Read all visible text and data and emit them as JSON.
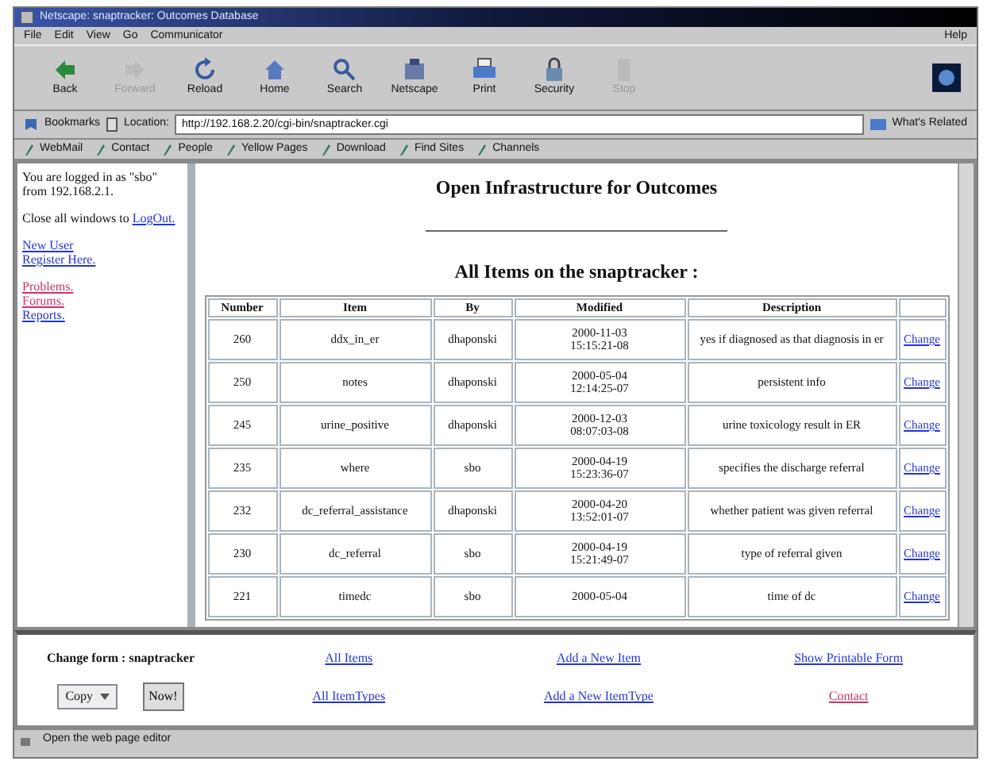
{
  "window": {
    "title": "Netscape: snaptracker: Outcomes Database"
  },
  "menu": [
    {
      "label": "File"
    },
    {
      "label": "Edit"
    },
    {
      "label": "View"
    },
    {
      "label": "Go"
    },
    {
      "label": "Communicator"
    }
  ],
  "help_menu": "Help",
  "toolbar": [
    {
      "label": "Back",
      "disabled": false
    },
    {
      "label": "Forward",
      "disabled": true
    },
    {
      "label": "Reload",
      "disabled": false
    },
    {
      "label": "Home",
      "disabled": false
    },
    {
      "label": "Search",
      "disabled": false
    },
    {
      "label": "Netscape",
      "disabled": false
    },
    {
      "label": "Print",
      "disabled": false
    },
    {
      "label": "Security",
      "disabled": false
    },
    {
      "label": "Stop",
      "disabled": true
    }
  ],
  "location_bar": {
    "bookmarks": "Bookmarks",
    "location_label": "Location:",
    "url": "http://192.168.2.20/cgi-bin/snaptracker.cgi",
    "related": "What's Related"
  },
  "personal_toolbar": [
    {
      "label": "WebMail"
    },
    {
      "label": "Contact"
    },
    {
      "label": "People"
    },
    {
      "label": "Yellow Pages"
    },
    {
      "label": "Download"
    },
    {
      "label": "Find Sites"
    },
    {
      "label": "Channels"
    }
  ],
  "sidebar": {
    "login_text": "You are logged in as \"sbo\" from 192.168.2.1.",
    "logout_text": "Close all windows to",
    "logout_link": "LogOut.",
    "links": [
      {
        "label": "New User",
        "visited": false
      },
      {
        "label": "Register Here.",
        "visited": false
      }
    ],
    "links_2": [
      {
        "label": "Problems.",
        "visited": true
      },
      {
        "label": "Forums.",
        "visited": true
      },
      {
        "label": "Reports.",
        "visited": false
      }
    ]
  },
  "main": {
    "title": "Open Infrastructure for Outcomes",
    "subtitle": "All Items on the snaptracker :",
    "table": {
      "columns": [
        "Number",
        "Item",
        "By",
        "Modified",
        "Description"
      ],
      "rows": [
        {
          "number": "260",
          "item": "ddx_in_er",
          "by": "dhaponski",
          "modified": [
            "2000-11-03",
            "15:15:21-08"
          ],
          "description": "yes if diagnosed as that diagnosis in er",
          "action": "Change"
        },
        {
          "number": "250",
          "item": "notes",
          "by": "dhaponski",
          "modified": [
            "2000-05-04",
            "12:14:25-07"
          ],
          "description": "persistent info",
          "action": "Change"
        },
        {
          "number": "245",
          "item": "urine_positive",
          "by": "dhaponski",
          "modified": [
            "2000-12-03",
            "08:07:03-08"
          ],
          "description": "urine toxicology result in ER",
          "action": "Change"
        },
        {
          "number": "235",
          "item": "where",
          "by": "sbo",
          "modified": [
            "2000-04-19",
            "15:23:36-07"
          ],
          "description": "specifies the discharge referral",
          "action": "Change"
        },
        {
          "number": "232",
          "item": "dc_referral_assistance",
          "by": "dhaponski",
          "modified": [
            "2000-04-20",
            "13:52:01-07"
          ],
          "description": "whether patient was given referral",
          "action": "Change"
        },
        {
          "number": "230",
          "item": "dc_referral",
          "by": "sbo",
          "modified": [
            "2000-04-19",
            "15:21:49-07"
          ],
          "description": "type of referral given",
          "action": "Change"
        },
        {
          "number": "221",
          "item": "timedc",
          "by": "sbo",
          "modified": [
            "2000-05-04"
          ],
          "description": "time of dc",
          "action": "Change"
        }
      ]
    }
  },
  "bottom": {
    "form_label": "Change form : snaptracker",
    "select_value": "Copy",
    "button": "Now!",
    "links": [
      {
        "label": "All Items",
        "visited": false
      },
      {
        "label": "Add a New Item",
        "visited": false
      },
      {
        "label": "Show Printable Form",
        "visited": false
      },
      {
        "label": "All ItemTypes",
        "visited": false
      },
      {
        "label": "Add a New ItemType",
        "visited": false
      },
      {
        "label": "Contact",
        "visited": true
      }
    ]
  },
  "status_bar": "Open the web page editor"
}
